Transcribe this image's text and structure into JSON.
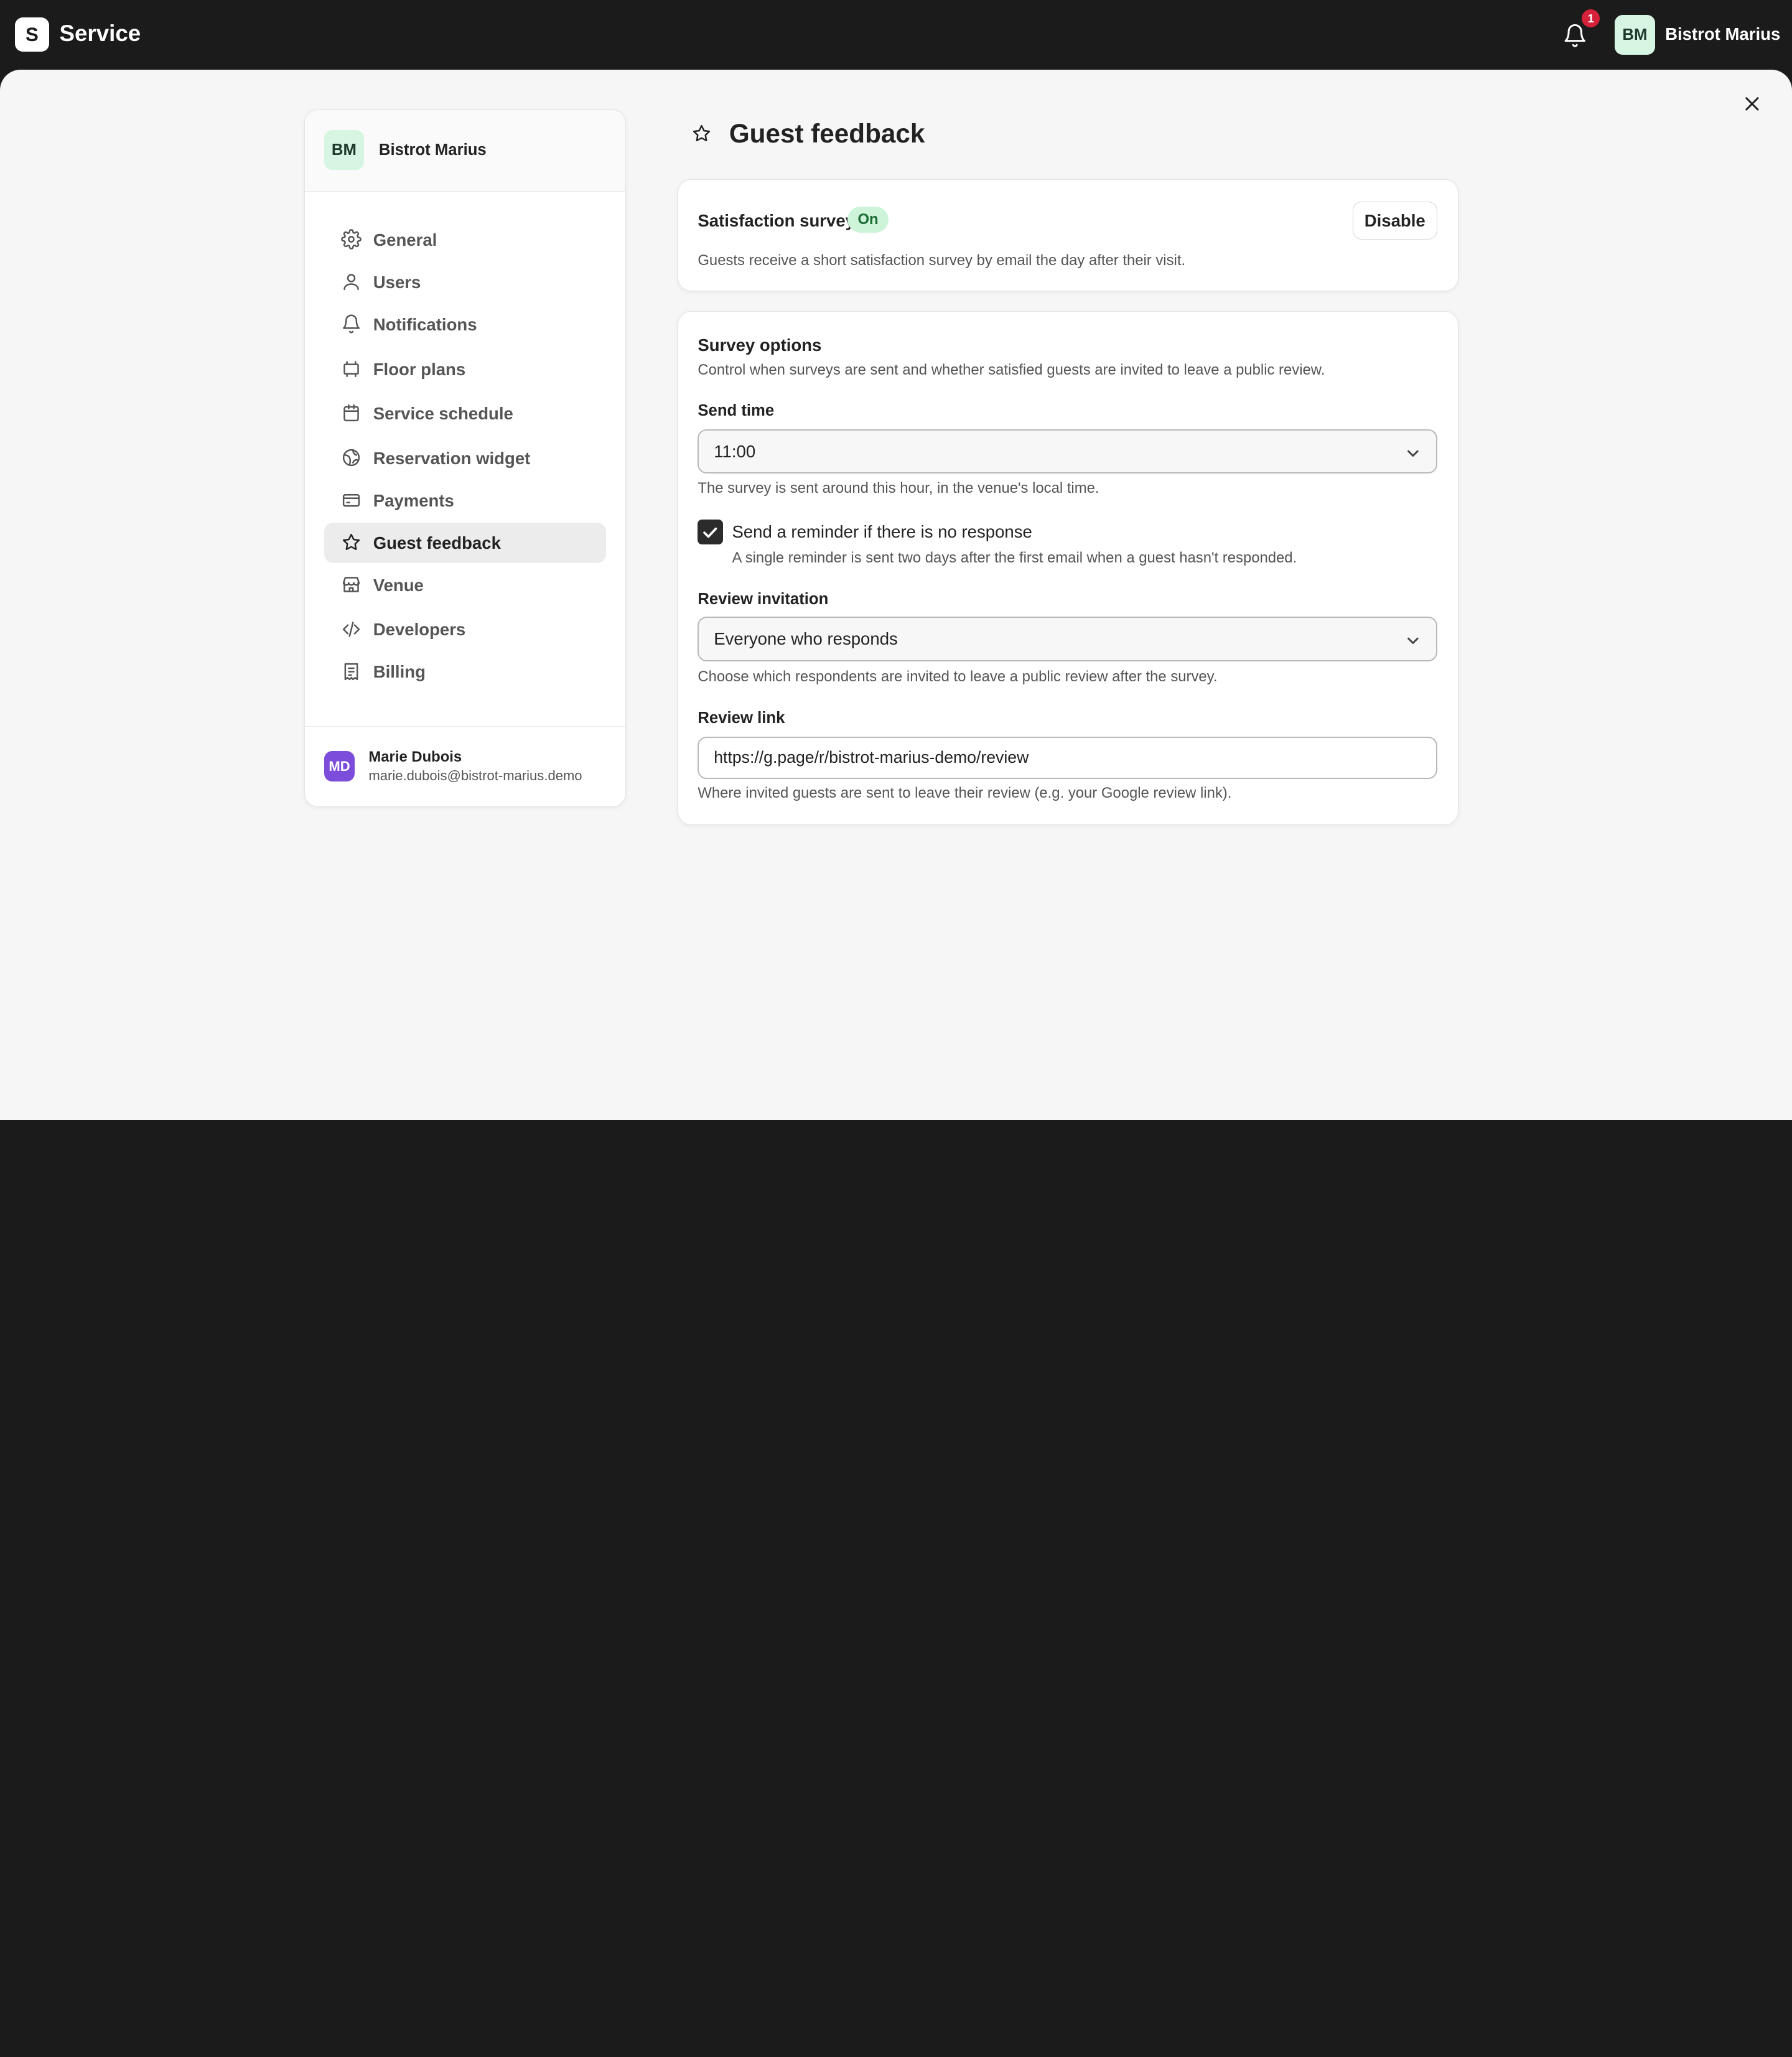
{
  "topbar": {
    "logo_letter": "S",
    "app_name": "Service",
    "notification_count": "1",
    "user_initials": "BM",
    "user_name": "Bistrot Marius"
  },
  "sidebar": {
    "venue_initials": "BM",
    "venue_name": "Bistrot Marius",
    "items": [
      {
        "label": "General",
        "icon": "gear-icon"
      },
      {
        "label": "Users",
        "icon": "user-icon"
      },
      {
        "label": "Notifications",
        "icon": "bell-icon"
      },
      {
        "label": "Floor plans",
        "icon": "floor-plan-icon"
      },
      {
        "label": "Service schedule",
        "icon": "calendar-icon"
      },
      {
        "label": "Reservation widget",
        "icon": "globe-icon"
      },
      {
        "label": "Payments",
        "icon": "credit-card-icon"
      },
      {
        "label": "Guest feedback",
        "icon": "star-icon",
        "active": true
      },
      {
        "label": "Venue",
        "icon": "store-icon"
      },
      {
        "label": "Developers",
        "icon": "code-icon"
      },
      {
        "label": "Billing",
        "icon": "receipt-icon"
      }
    ],
    "account": {
      "initials": "MD",
      "name": "Marie Dubois",
      "email": "marie.dubois@bistrot-marius.demo"
    }
  },
  "page": {
    "title": "Guest feedback",
    "title_icon": "star-icon"
  },
  "satisfaction": {
    "title": "Satisfaction survey",
    "status": "On",
    "disable_label": "Disable",
    "description": "Guests receive a short satisfaction survey by email the day after their visit."
  },
  "survey_options": {
    "title": "Survey options",
    "description": "Control when surveys are sent and whether satisfied guests are invited to leave a public review.",
    "send_time": {
      "label": "Send time",
      "value": "11:00",
      "help": "The survey is sent around this hour, in the venue's local time."
    },
    "reminder": {
      "checked": true,
      "label": "Send a reminder if there is no response",
      "help": "A single reminder is sent two days after the first email when a guest hasn't responded."
    },
    "review_invitation": {
      "label": "Review invitation",
      "value": "Everyone who responds",
      "help": "Choose which respondents are invited to leave a public review after the survey."
    },
    "review_link": {
      "label": "Review link",
      "value": "https://g.page/r/bistrot-marius-demo/review",
      "help": "Where invited guests are sent to leave their review (e.g. your Google review link)."
    }
  },
  "colors": {
    "topbar": "#1b1b1b",
    "badge_red": "#d6213a",
    "on_badge_bg": "#cdf3d8",
    "venue_avatar_bg": "#d6f5e3",
    "account_avatar_bg": "#7c4ddb"
  }
}
